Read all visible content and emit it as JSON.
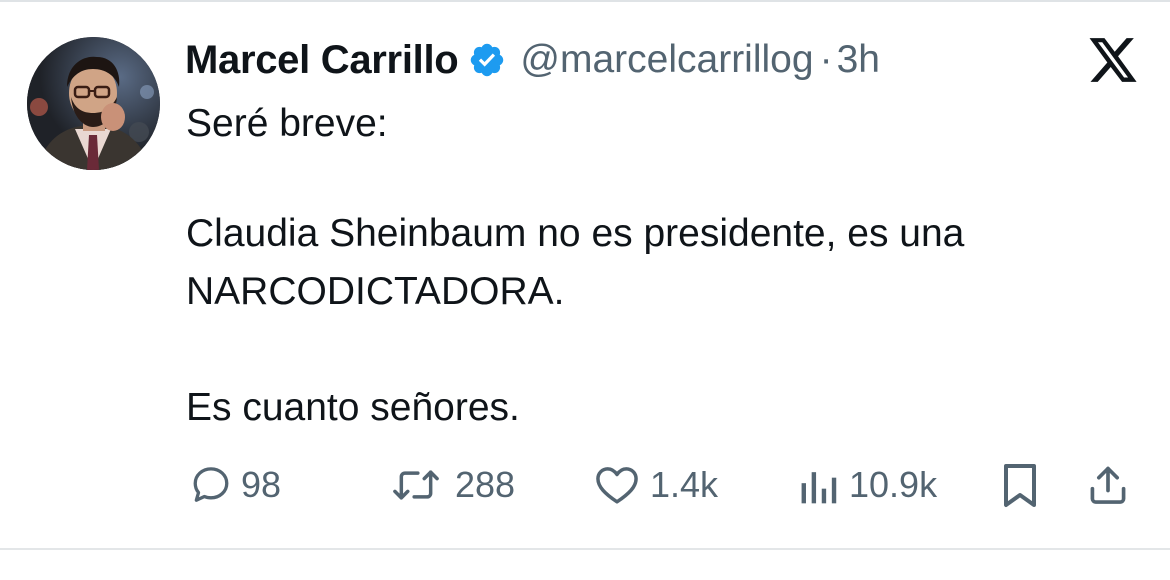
{
  "tweet": {
    "author": {
      "display_name": "Marcel Carrillo",
      "handle": "@marcelcarrillog",
      "verified": true
    },
    "separator": "·",
    "time_ago": "3h",
    "text_lines": [
      "Seré breve:",
      "Claudia Sheinbaum no es presidente, es una",
      "NARCODICTADORA.",
      "Es cuanto señores."
    ],
    "stats": {
      "replies": "98",
      "retweets": "288",
      "likes": "1.4k",
      "views": "10.9k"
    }
  },
  "icons": {
    "verified": "verified-badge-icon",
    "platform": "x-logo-icon",
    "reply": "reply-icon",
    "retweet": "retweet-icon",
    "like": "heart-icon",
    "views": "views-icon",
    "bookmark": "bookmark-icon",
    "share": "share-icon"
  },
  "colors": {
    "text_primary": "#0f1419",
    "text_secondary": "#536471",
    "verified_blue": "#1d9bf0",
    "background": "#ffffff"
  }
}
